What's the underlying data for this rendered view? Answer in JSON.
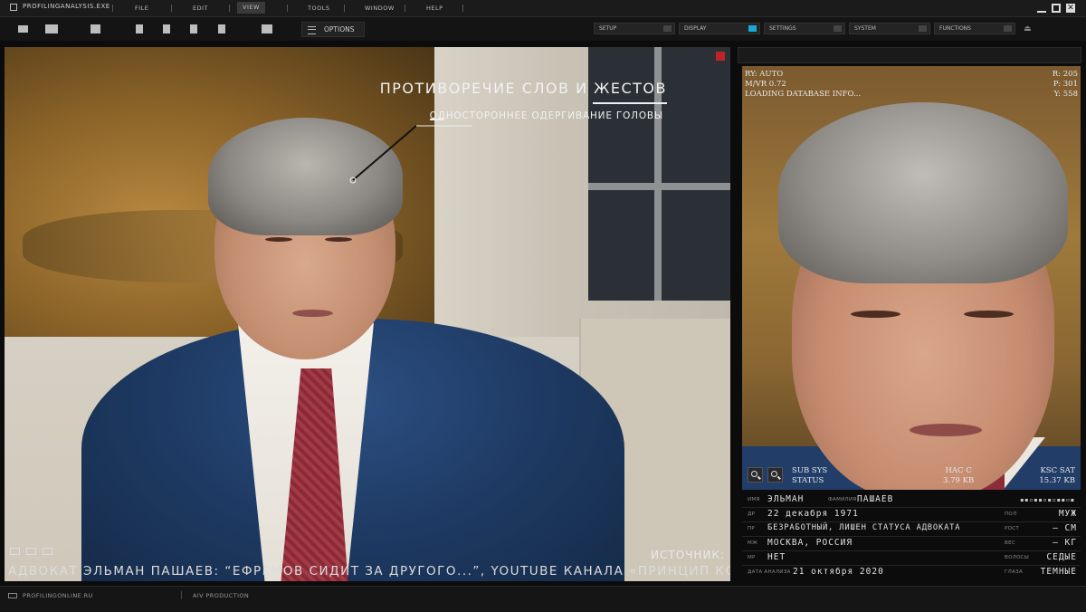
{
  "app": {
    "title": "PROFILINGANALYSIS.EXE"
  },
  "menu": {
    "items": [
      "FILE",
      "EDIT",
      "VIEW",
      "TOOLS",
      "WINDOW",
      "HELP"
    ],
    "active": "VIEW"
  },
  "toolbar": {
    "options_label": "OPTIONS",
    "panels": [
      {
        "label": "SETUP",
        "on": false
      },
      {
        "label": "DISPLAY",
        "on": true
      },
      {
        "label": "SETTINGS",
        "on": false
      },
      {
        "label": "SYSTEM",
        "on": false
      },
      {
        "label": "FUNCTIONS",
        "on": false
      }
    ]
  },
  "main_video": {
    "annotation_title": "ПРОТИВОРЕЧИЕ СЛОВ И ЖЕСТОВ",
    "annotation_sub": "ОДНОСТОРОННЕЕ ОДЕРГИВАНИЕ ГОЛОВЫ",
    "source_label": "ИСТОЧНИК:",
    "caption": "АДВОКАТ ЭЛЬМАН ПАШАЕВ: “ЕФРЕМОВ СИДИТ ЗА ДРУГОГО...”, YOUTUBE КАНАЛА «ПРИНЦИП КОВАЛЕВА»"
  },
  "zoom_panel": {
    "top_left": [
      "RY: AUTO",
      "M/VR 0.72",
      "LOADING DATABASE INFO..."
    ],
    "top_right": [
      "R: 205",
      "P: 301",
      "Y: 558"
    ],
    "bottom_left": [
      "SUB SYS",
      "STATUS"
    ],
    "bottom_mid": [
      "HAC C",
      "3.79 KB"
    ],
    "bottom_right": [
      "KSC SAT",
      "15.37 KB"
    ]
  },
  "profile": {
    "name_label": "ИМЯ",
    "name": "ЭЛЬМАН",
    "surname_label": "ФАМИЛИЯ",
    "surname": "ПАШАЕВ",
    "dob_label": "ДР",
    "dob": "22 декабря 1971",
    "gender_label": "ПОЛ",
    "gender": "МУЖ",
    "job_label": "ПР",
    "job": "БЕЗРАБОТНЫЙ, ЛИШЕН СТАТУСА АДВОКАТА",
    "height_label": "РОСТ",
    "height": "– СМ",
    "place_label": "МЖ",
    "place": "МОСКВА, РОССИЯ",
    "weight_label": "ВЕС",
    "weight": "– КГ",
    "mr_label": "МР",
    "mr": "НЕТ",
    "hair_label": "ВОЛОСЫ",
    "hair": "СЕДЫЕ",
    "date_label": "ДАТА АНАЛИЗА",
    "date": "21 октября 2020",
    "eyes_label": "ГЛАЗА",
    "eyes": "ТЕМНЫЕ"
  },
  "status": {
    "site": "PROFILINGONLINE.RU",
    "production": "AIV PRODUCTION"
  },
  "colors": {
    "accent": "#1aa9d6",
    "close": "#c0222a"
  }
}
